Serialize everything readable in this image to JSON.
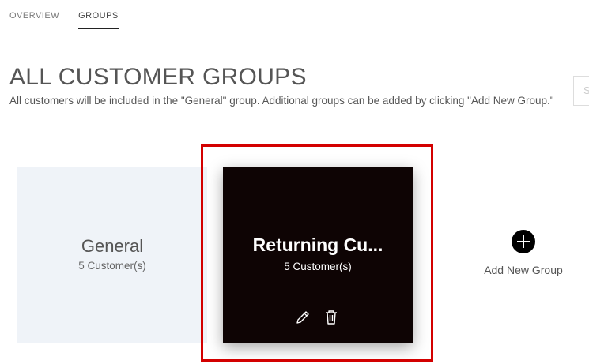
{
  "tabs": [
    {
      "label": "OVERVIEW",
      "active": false
    },
    {
      "label": "GROUPS",
      "active": true
    }
  ],
  "page": {
    "title": "ALL CUSTOMER GROUPS",
    "description": "All customers will be included in the \"General\" group. Additional groups can be added by clicking \"Add New Group.\"",
    "search_placeholder": "S"
  },
  "groups": [
    {
      "name": "General",
      "count": "5 Customer(s)"
    },
    {
      "name": "Returning Cu...",
      "count": "5 Customer(s)",
      "actions": [
        "pencil-icon",
        "trash-icon"
      ]
    }
  ],
  "add_group": {
    "label": "Add New Group",
    "icon": "plus-circle-icon"
  },
  "colors": {
    "highlight": "#d30000",
    "card_dark": "#0e0404",
    "card_light": "#eff3f8"
  }
}
